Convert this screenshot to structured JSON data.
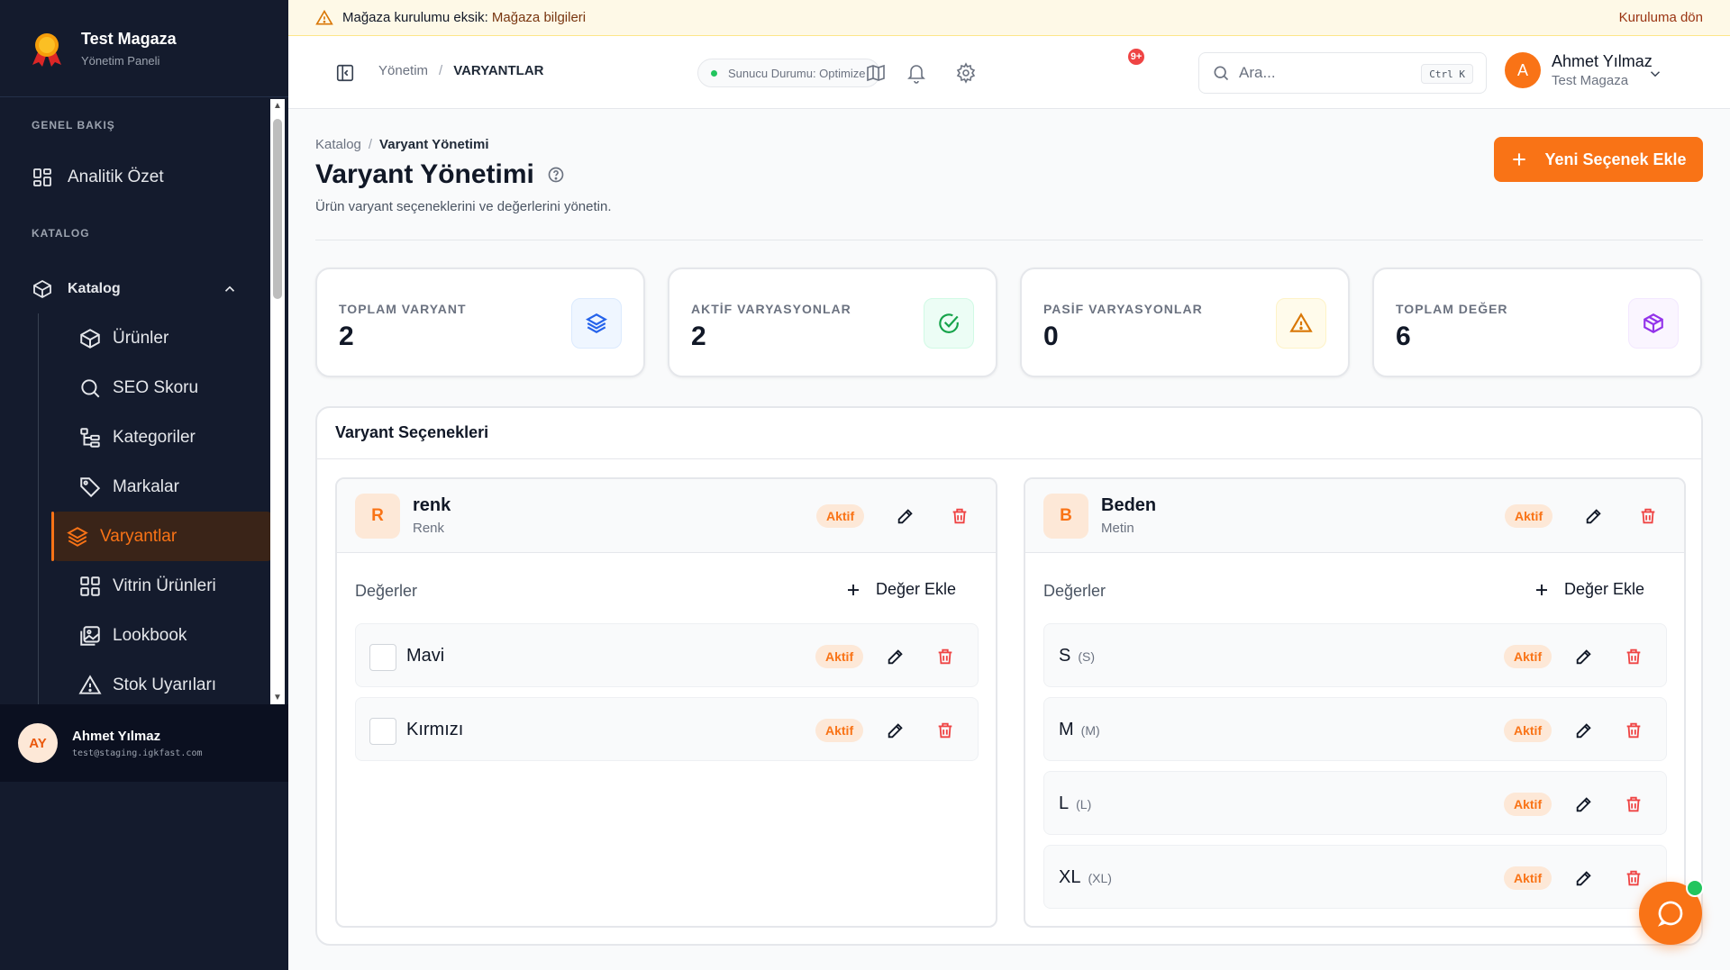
{
  "brand": {
    "name": "Test Magaza",
    "sub": "Yönetim Paneli"
  },
  "sidebar": {
    "section_overview": "GENEL BAKIŞ",
    "analytics": "Analitik Özet",
    "section_catalog": "KATALOG",
    "catalog": "Katalog",
    "items": [
      {
        "label": "Ürünler",
        "icon": "box-icon"
      },
      {
        "label": "SEO Skoru",
        "icon": "search-icon"
      },
      {
        "label": "Kategoriler",
        "icon": "tree-icon"
      },
      {
        "label": "Markalar",
        "icon": "tag-icon"
      },
      {
        "label": "Varyantlar",
        "icon": "layers-icon",
        "active": true
      },
      {
        "label": "Vitrin Ürünleri",
        "icon": "grid-icon"
      },
      {
        "label": "Lookbook",
        "icon": "gallery-icon"
      },
      {
        "label": "Stok Uyarıları",
        "icon": "warning-icon"
      }
    ],
    "user": {
      "initials": "AY",
      "name": "Ahmet Yılmaz",
      "email": "test@staging.igkfast.com"
    }
  },
  "banner": {
    "text_prefix": "Mağaza kurulumu eksik:",
    "text_value": "Mağaza bilgileri",
    "link": "Kuruluma dön"
  },
  "header": {
    "crumb_root": "Yönetim",
    "crumb_sep": "/",
    "crumb_current": "VARYANTLAR",
    "server_status": "Sunucu Durumu: Optimize",
    "notif_count": "9+",
    "search_placeholder": "Ara...",
    "search_shortcut": "Ctrl K",
    "user_initial": "A",
    "user_name": "Ahmet Yılmaz",
    "user_store": "Test Magaza"
  },
  "page": {
    "crumb_root": "Katalog",
    "crumb_sep": "/",
    "crumb_current": "Varyant Yönetimi",
    "title": "Varyant Yönetimi",
    "subtitle": "Ürün varyant seçeneklerini ve değerlerini yönetin.",
    "new_button": "Yeni Seçenek Ekle"
  },
  "stats": [
    {
      "label": "TOPLAM VARYANT",
      "value": "2",
      "icon": "layers-icon",
      "color": "#2563eb",
      "bg": "#eff6ff"
    },
    {
      "label": "AKTİF VARYASYONLAR",
      "value": "2",
      "icon": "check-circle-icon",
      "color": "#16a34a",
      "bg": "#ecfdf5"
    },
    {
      "label": "PASİF VARYASYONLAR",
      "value": "0",
      "icon": "warning-icon",
      "color": "#d97706",
      "bg": "#fffbeb"
    },
    {
      "label": "TOPLAM DEĞER",
      "value": "6",
      "icon": "cube-icon",
      "color": "#9333ea",
      "bg": "#faf5ff"
    }
  ],
  "panel": {
    "title": "Varyant Seçenekleri",
    "options": [
      {
        "letter": "R",
        "name": "renk",
        "type": "Renk",
        "status": "Aktif",
        "values_label": "Değerler",
        "add_label": "Değer Ekle",
        "values": [
          {
            "name": "Mavi",
            "code": "",
            "status": "Aktif"
          },
          {
            "name": "Kırmızı",
            "code": "",
            "status": "Aktif"
          }
        ]
      },
      {
        "letter": "B",
        "name": "Beden",
        "type": "Metin",
        "status": "Aktif",
        "values_label": "Değerler",
        "add_label": "Değer Ekle",
        "values": [
          {
            "name": "S",
            "code": "(S)",
            "status": "Aktif"
          },
          {
            "name": "M",
            "code": "(M)",
            "status": "Aktif"
          },
          {
            "name": "L",
            "code": "(L)",
            "status": "Aktif"
          },
          {
            "name": "XL",
            "code": "(XL)",
            "status": "Aktif"
          }
        ]
      }
    ]
  },
  "colors": {
    "accent": "#f97316",
    "sidebar_bg": "#141b2d",
    "danger": "#ef4444"
  }
}
